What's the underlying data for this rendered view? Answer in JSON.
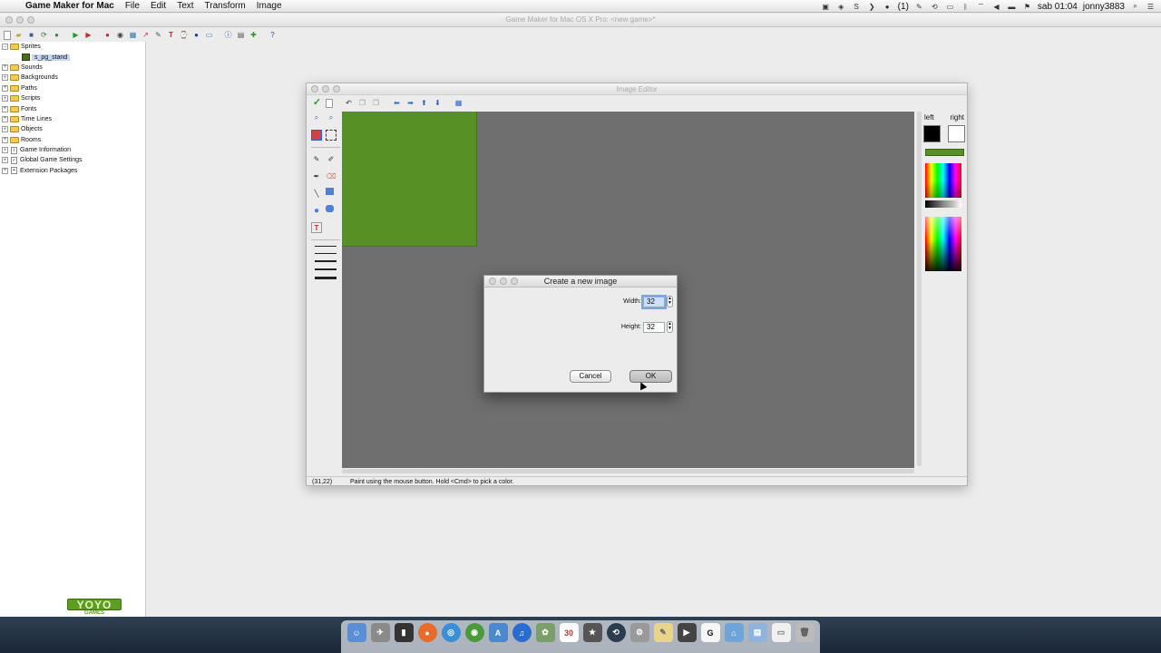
{
  "menubar": {
    "app_name": "Game Maker for Mac",
    "menus": [
      "File",
      "Edit",
      "Text",
      "Transform",
      "Image"
    ],
    "right": {
      "badge": "(1)",
      "clock": "sab 01:04",
      "user": "jonny3883"
    }
  },
  "main_window": {
    "title": "Game Maker for Mac OS X Pro: <new game>*"
  },
  "tree": {
    "sprites_label": "Sprites",
    "sprite_item": "s_pg_stand",
    "sounds_label": "Sounds",
    "backgrounds_label": "Backgrounds",
    "paths_label": "Paths",
    "scripts_label": "Scripts",
    "fonts_label": "Fonts",
    "timelines_label": "Time Lines",
    "objects_label": "Objects",
    "rooms_label": "Rooms",
    "game_info_label": "Game Information",
    "global_settings_label": "Global Game Settings",
    "extensions_label": "Extension Packages"
  },
  "logo": {
    "text": "YOYO",
    "subtext": "GAMES"
  },
  "image_editor": {
    "title": "Image Editor",
    "palette": {
      "left_label": "left",
      "right_label": "right",
      "left_color": "#000000",
      "right_color": "#ffffff",
      "current_color": "#579126"
    },
    "status": {
      "coords": "(31,22)",
      "hint": "Paint using the mouse button. Hold <Cmd> to pick a color."
    }
  },
  "dialog": {
    "title": "Create a new image",
    "width_label": "Width:",
    "width_value": "32",
    "height_label": "Height:",
    "height_value": "32",
    "cancel_label": "Cancel",
    "ok_label": "OK"
  },
  "dock": {
    "calendar_day": "30"
  }
}
